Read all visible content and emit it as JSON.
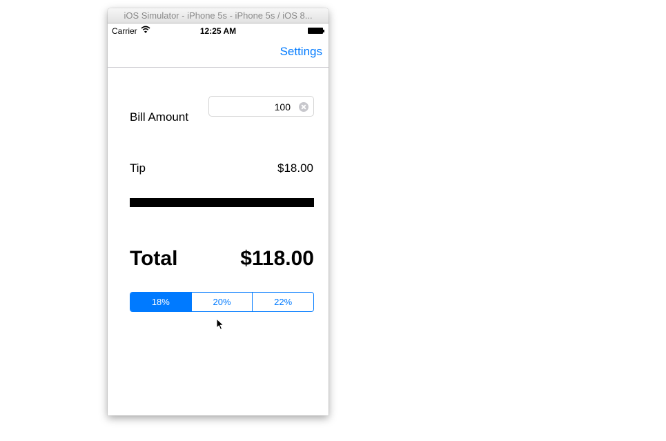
{
  "window": {
    "title": "iOS Simulator - iPhone 5s - iPhone 5s / iOS 8..."
  },
  "status_bar": {
    "carrier": "Carrier",
    "time": "12:25 AM",
    "wifi_icon": "wifi-icon",
    "battery_icon": "battery-icon"
  },
  "nav_bar": {
    "settings_label": "Settings"
  },
  "form": {
    "bill_label": "Bill Amount",
    "bill_value": "100",
    "clear_icon": "clear-icon",
    "tip_label": "Tip",
    "tip_value": "$18.00",
    "total_label": "Total",
    "total_value": "$118.00"
  },
  "tip_selector": {
    "options": [
      "18%",
      "20%",
      "22%"
    ],
    "selected_index": 0
  },
  "colors": {
    "accent": "#007aff",
    "text": "#000000",
    "divider": "#000000"
  }
}
